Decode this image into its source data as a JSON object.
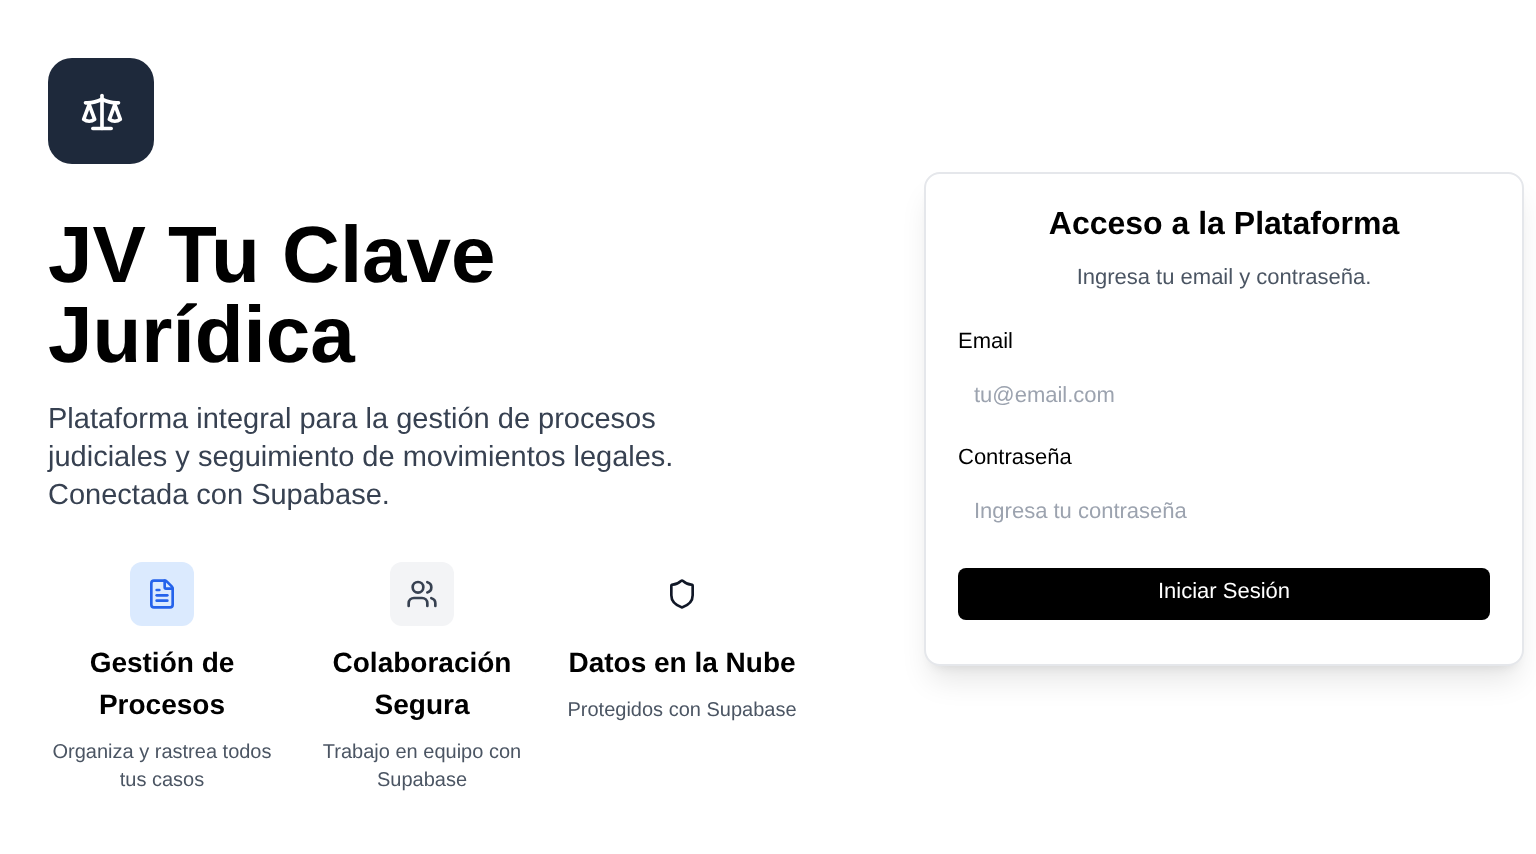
{
  "hero": {
    "title": "JV Tu Clave Jurídica",
    "description": "Plataforma integral para la gestión de procesos judiciales y seguimiento de movimientos legales. Conectada con Supabase."
  },
  "features": [
    {
      "kind": "document",
      "title": "Gestión de Procesos",
      "text": "Organiza y rastrea todos tus casos"
    },
    {
      "kind": "users",
      "title": "Colaboración Segura",
      "text": "Trabajo en equipo con Supabase"
    },
    {
      "kind": "shield",
      "title": "Datos en la Nube",
      "text": "Protegidos con Supabase"
    }
  ],
  "login": {
    "title": "Acceso a la Plataforma",
    "subtitle": "Ingresa tu email y contraseña.",
    "fields": [
      {
        "label": "Email",
        "placeholder": "tu@email.com"
      },
      {
        "label": "Contraseña",
        "placeholder": "Ingresa tu contraseña"
      }
    ],
    "button": "Iniciar Sesión"
  }
}
